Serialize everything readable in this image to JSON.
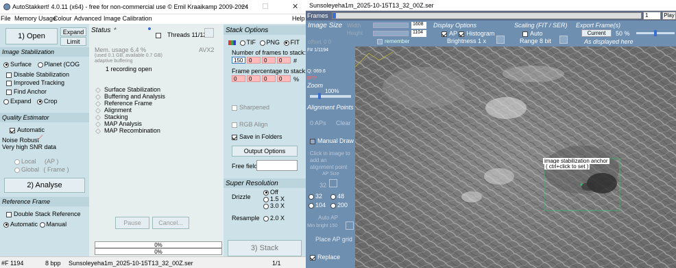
{
  "app": {
    "title": "AutoStakkert! 4.0.11 (x64) - free for non-commercial use © Emil Kraaikamp 2009-2024",
    "minimize": "—",
    "maximize": "☐",
    "close": "✕"
  },
  "menu": {
    "file": "File",
    "memory": "Memory Usage",
    "colour": "Colour",
    "advanced": "Advanced",
    "calibration": "Image Calibration",
    "help": "Help"
  },
  "left": {
    "open_button": "1) Open",
    "expand_button": "Expand",
    "limit_button": "Limit",
    "image_stabilization": "Image Stabilization",
    "surface": "Surface",
    "planet": "Planet (COG",
    "disable_stab": "Disable Stabilization",
    "improved_tracking": "Improved Tracking",
    "find_anchor": "Find Anchor",
    "expand_radio": "Expand",
    "crop_radio": "Crop",
    "quality_estimator": "Quality Estimator",
    "automatic": "Automatic",
    "noise_robust": "Noise Robust",
    "snr": "Very high SNR data",
    "local": "Local",
    "local_ap": "(AP )",
    "global": "Global",
    "global_frame": "( Frame )",
    "analyse_button": "2) Analyse",
    "reference_frame": "Reference Frame",
    "double_stack": "Double Stack Reference",
    "auto_radio": "Automatic",
    "manual_radio": "Manual"
  },
  "status": {
    "title": "Status",
    "threads": "Threads 11/12",
    "mem_usage": "Mem. usage 6.4 %",
    "avx": "AVX2",
    "used": "(used 0.1 GB, available 0.7 GB)",
    "adaptive": "adaptive buffering",
    "recording": "1 recording open",
    "steps": [
      "Surface Stabilization",
      "Buffering and Analysis",
      "Reference Frame",
      "Alignment",
      "Stacking",
      "MAP Analysis",
      "MAP Recombination"
    ],
    "pause": "Pause",
    "cancel": "Cancel...",
    "progress1": "0%",
    "progress2": "0%"
  },
  "stack": {
    "title": "Stack Options",
    "tif": "TIF",
    "png": "PNG",
    "fit": "FIT",
    "frames_label": "Number of frames to stack:",
    "frames_values": [
      "150",
      "0",
      "0",
      "0"
    ],
    "frames_suffix": "#",
    "pct_label": "Frame percentage to stack:",
    "pct_values": [
      "0",
      "0",
      "0",
      "0"
    ],
    "pct_suffix": "%",
    "sharpened": "Sharpened",
    "rgb_align": "RGB Align",
    "save_folders": "Save in Folders",
    "output_options": "Output Options",
    "free_field": "Free field",
    "super_resolution": "Super Resolution",
    "drizzle": "Drizzle",
    "off": "Off",
    "x15": "1.5 X",
    "x30": "3.0 X",
    "resample": "Resample",
    "x20": "2.0 X",
    "stack_button": "3) Stack"
  },
  "statusbar": {
    "frame": "#F 1194",
    "bpp": "8 bpp",
    "file": "Sunsoleyeha1m_2025-10-15T13_32_00Z.ser",
    "page": "1/1"
  },
  "ser": {
    "title": "Sunsoleyeha1m_2025-10-15T13_32_00Z.ser",
    "frames": "Frames",
    "frame_num": "1",
    "play": "Play",
    "image_size": "Image Size",
    "width_label": "Width",
    "height_label": "Height",
    "width_val": "1608",
    "height_val": "1104",
    "offset": "offset",
    "offset_val": "0 0",
    "remember": "remember",
    "display_options": "Display Options",
    "ap": "AP",
    "histogram": "Histogram",
    "brightness": "Brightness 1 x",
    "scaling": "Scaling (FIT / SER)",
    "auto": "Auto",
    "range": "Range 8 bit",
    "export": "Export Frame(s)",
    "current": "Current",
    "pct": "50 %",
    "as_displayed": "As displayed here",
    "frame_info": "F# 1/1194",
    "q": "Q: 069.6",
    "gray": "gray",
    "zoom": "Zoom",
    "zoom_val": "100%",
    "alignment_points": "Alignment Points",
    "aps_count": "0 APs",
    "clear": "Clear",
    "manual_draw": "Manual Draw",
    "click_hint": "Click in image to add an alignment point",
    "ap_size_label": "AP Size",
    "ap_size": "32",
    "s32": "32",
    "s48": "48",
    "s104": "104",
    "s200": "200",
    "auto_ap": "Auto AP",
    "min_bright": "Min bright 150",
    "place_grid": "Place AP grid",
    "replace": "Replace",
    "anchor_label": "image stabilization anchor",
    "anchor_hint": "( ctrl+click to set )"
  },
  "colors": {
    "panel": "#cde2e8",
    "ser_panel": "#6e8fb0",
    "input_pink": "#ffbbbb"
  }
}
